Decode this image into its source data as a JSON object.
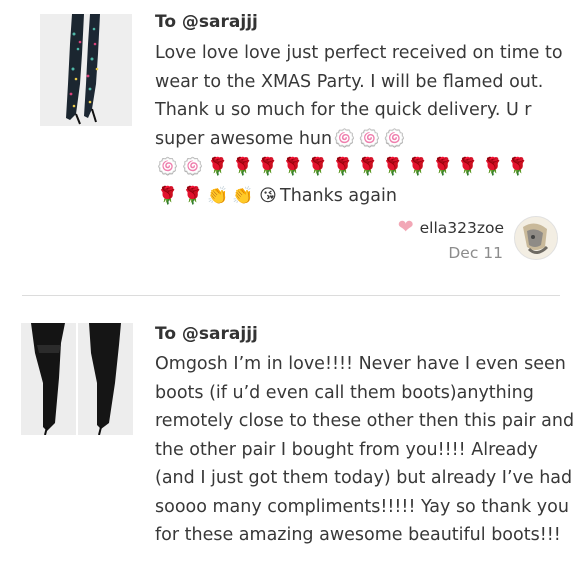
{
  "reviews": [
    {
      "to": "To @sarajjj",
      "message": "Love love love just perfect received on time to wear to the XMAS Party. I will be flamed out. Thank u so much for the quick delivery. U r super awesome hun",
      "emoji_line1": [
        "🍥",
        "🍥",
        "🍥"
      ],
      "emoji_line2": [
        "🍥",
        "🍥",
        "🌹",
        "🌹",
        "🌹",
        "🌹",
        "🌹",
        "🌹",
        "🌹",
        "🌹",
        "🌹",
        "🌹",
        "🌹",
        "🌹",
        "🌹"
      ],
      "emoji_line3": [
        "🌹",
        "🌹",
        "👏",
        "👏",
        "😘"
      ],
      "message_tail": "Thanks again",
      "author": "ella323zoe",
      "date": "Dec 11"
    },
    {
      "to": "To @sarajjj",
      "message": "Omgosh I’m in love!!!! Never have I even seen boots (if u’d even call them boots)anything remotely close to these other then this pair and the other pair I bought from you!!!! Already (and I just got them today) but already I’ve had soooo many compliments!!!!! Yay so thank you for these amazing awesome beautiful boots!!!"
    }
  ],
  "icons": {
    "heart": "heart-icon",
    "avatar": "avatar"
  },
  "colors": {
    "heart": "#f2a7b6",
    "date": "#8c8c8c",
    "divider": "#dcdcdc"
  }
}
